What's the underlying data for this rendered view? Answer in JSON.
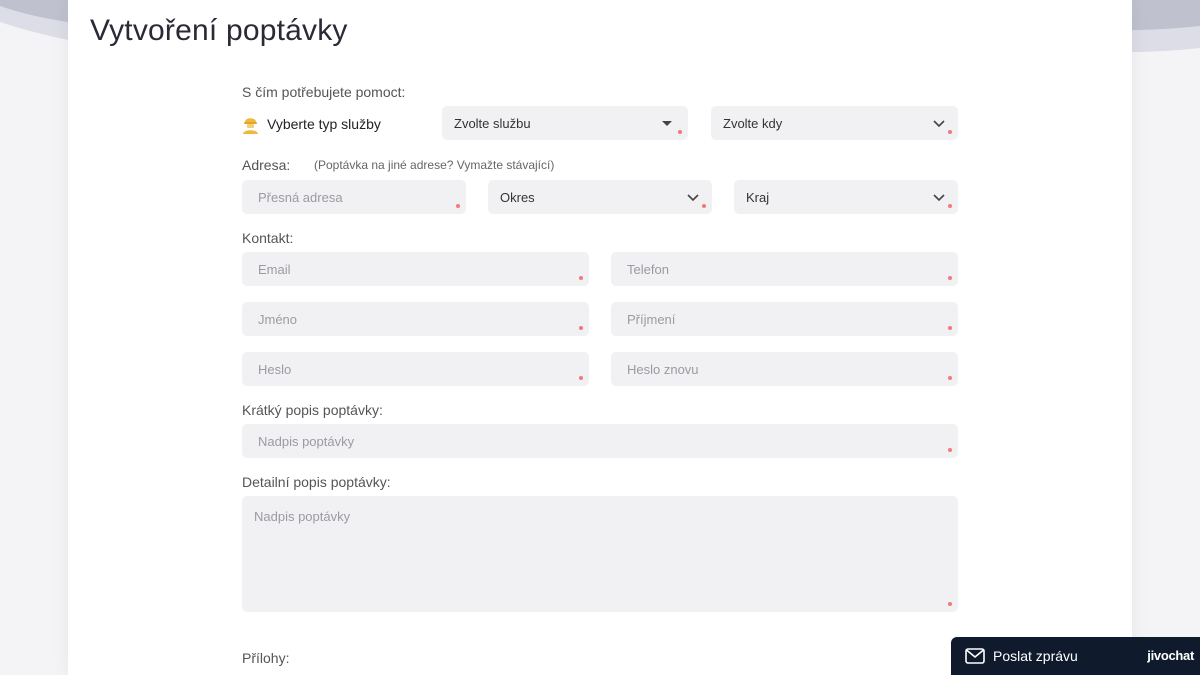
{
  "page_title": "Vytvoření poptávky",
  "help_label": "S čím potřebujete pomoct:",
  "service": {
    "type_label": "Vyberte typ služby",
    "service_select": "Zvolte službu",
    "when_select": "Zvolte kdy"
  },
  "address": {
    "label": "Adresa:",
    "note": "(Poptávka na jiné adrese? Vymažte stávající)",
    "exact_placeholder": "Přesná adresa",
    "district": "Okres",
    "region": "Kraj"
  },
  "contact": {
    "label": "Kontakt:",
    "email_placeholder": "Email",
    "phone_placeholder": "Telefon",
    "first_name_placeholder": "Jméno",
    "last_name_placeholder": "Příjmení",
    "password_placeholder": "Heslo",
    "password_again_placeholder": "Heslo znovu"
  },
  "short_desc": {
    "label": "Krátký popis poptávky:",
    "placeholder": "Nadpis poptávky"
  },
  "detail_desc": {
    "label": "Detailní popis poptávky:",
    "placeholder": "Nadpis poptávky"
  },
  "attachments_label": "Přílohy:",
  "chat": {
    "button_label": "Poslat zprávu",
    "brand": "jivochat"
  },
  "colors": {
    "required_dot": "#f07a7a",
    "field_bg": "#f1f1f4",
    "chat_bg": "#0f1b2d"
  }
}
